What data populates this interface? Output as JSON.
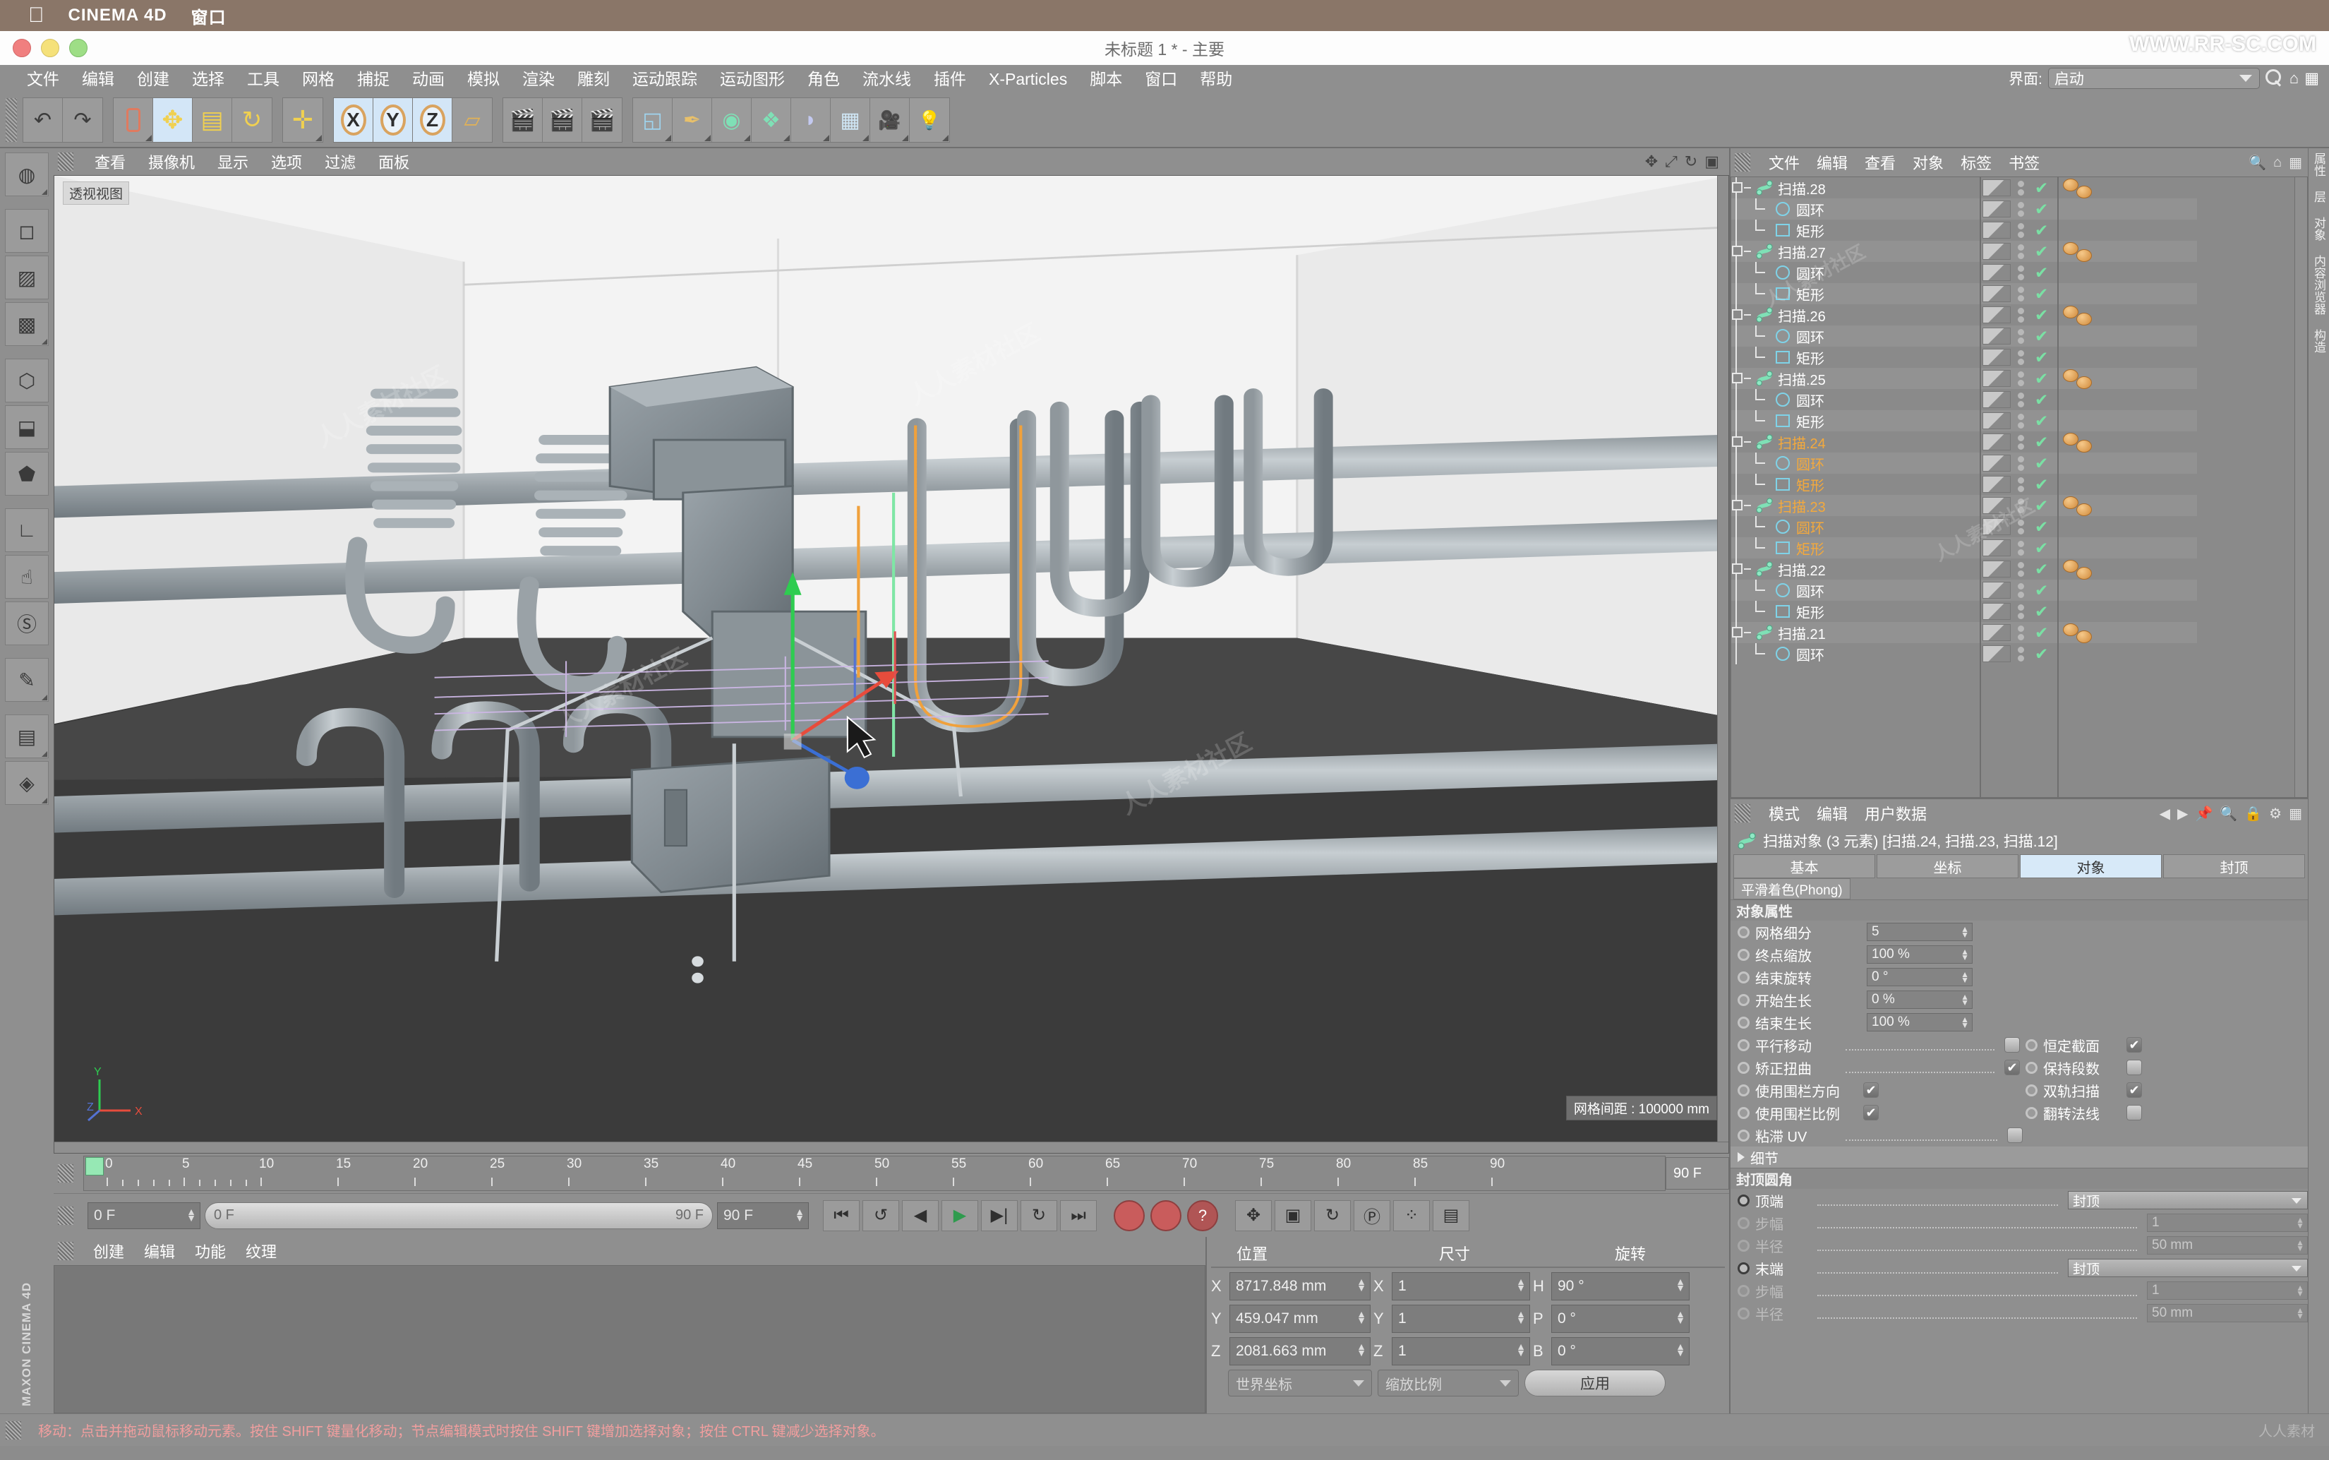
{
  "os": {
    "apple": "",
    "app_name": "CINEMA 4D",
    "window_menu": "窗口"
  },
  "window": {
    "title": "未标题 1 * - 主要",
    "watermark": "WWW.RR-SC.COM"
  },
  "menubar": {
    "items": [
      "文件",
      "编辑",
      "创建",
      "选择",
      "工具",
      "网格",
      "捕捉",
      "动画",
      "模拟",
      "渲染",
      "雕刻",
      "运动跟踪",
      "运动图形",
      "角色",
      "流水线",
      "插件",
      "X-Particles",
      "脚本",
      "窗口",
      "帮助"
    ],
    "interface_label": "界面:",
    "interface_value": "启动"
  },
  "toolbar": {
    "groups": [
      {
        "buttons": [
          {
            "name": "undo",
            "glyph": "↶"
          },
          {
            "name": "redo",
            "glyph": "↷"
          }
        ]
      },
      {
        "buttons": [
          {
            "name": "live-selection",
            "glyph": "▯"
          },
          {
            "name": "move",
            "glyph": "✥",
            "active": true
          },
          {
            "name": "scale",
            "glyph": "▤"
          },
          {
            "name": "rotate",
            "glyph": "↻"
          }
        ]
      },
      {
        "buttons": [
          {
            "name": "move-tool",
            "glyph": "✛"
          }
        ]
      },
      {
        "buttons": [
          {
            "name": "axis-x",
            "glyph": "X",
            "active": true
          },
          {
            "name": "axis-y",
            "glyph": "Y",
            "active": true
          },
          {
            "name": "axis-z",
            "glyph": "Z",
            "active": true
          },
          {
            "name": "world-coord",
            "glyph": "▱"
          }
        ]
      },
      {
        "buttons": [
          {
            "name": "render-view",
            "glyph": "▶"
          },
          {
            "name": "render-region",
            "glyph": "▶"
          },
          {
            "name": "render-settings",
            "glyph": "▶"
          }
        ]
      },
      {
        "buttons": [
          {
            "name": "cube-primitive",
            "glyph": "◱"
          },
          {
            "name": "spline-pen",
            "glyph": "✒"
          },
          {
            "name": "nurbs",
            "glyph": "◉"
          },
          {
            "name": "array",
            "glyph": "❖"
          },
          {
            "name": "bend-deformer",
            "glyph": "◗"
          },
          {
            "name": "environment",
            "glyph": "▦"
          },
          {
            "name": "camera",
            "glyph": "📷"
          },
          {
            "name": "light",
            "glyph": "💡"
          }
        ]
      }
    ]
  },
  "leftstrip": {
    "buttons": [
      {
        "name": "texture-axis",
        "glyph": "◍"
      },
      {
        "name": "model-mode",
        "glyph": "◻"
      },
      {
        "name": "object-mode",
        "glyph": "▨"
      },
      {
        "name": "texture-mode",
        "glyph": "▩"
      },
      {
        "name": "points-mode",
        "glyph": "⬡"
      },
      {
        "name": "edges-mode",
        "glyph": "⬓"
      },
      {
        "name": "polygons-mode",
        "glyph": "⬟"
      },
      {
        "name": "workplane",
        "glyph": "∟"
      },
      {
        "name": "animation-mode",
        "glyph": "☝"
      },
      {
        "name": "lock-axis",
        "glyph": "Ⓢ"
      },
      {
        "name": "enable-snap",
        "glyph": "✎"
      },
      {
        "name": "lock-workplane",
        "glyph": "▤"
      },
      {
        "name": "planar-workplane",
        "glyph": "◈"
      }
    ],
    "brand": "MAXON CINEMA 4D"
  },
  "viewport": {
    "menu": [
      "查看",
      "摄像机",
      "显示",
      "选项",
      "过滤",
      "面板"
    ],
    "label": "透视视图",
    "grid_info": "网格间距 : 100000 mm",
    "axis": {
      "x": "X",
      "y": "Y",
      "z": "Z"
    }
  },
  "timeline": {
    "ticks": [
      0,
      5,
      10,
      15,
      20,
      25,
      30,
      35,
      40,
      45,
      50,
      55,
      60,
      65,
      70,
      75,
      80,
      85,
      90
    ],
    "playhead_frame": "0",
    "current_frame": "0 F",
    "range_start": "0 F",
    "range_end": "90 F",
    "end_frame": "90 F",
    "preview_end": "90 F"
  },
  "transport": {
    "buttons": [
      {
        "name": "go-to-start",
        "glyph": "⏮"
      },
      {
        "name": "play-reverse-loop",
        "glyph": "↺"
      },
      {
        "name": "step-back",
        "glyph": "◀"
      },
      {
        "name": "play",
        "glyph": "▶"
      },
      {
        "name": "step-forward",
        "glyph": "▶|"
      },
      {
        "name": "loop",
        "glyph": "↻"
      },
      {
        "name": "go-to-end",
        "glyph": "⏭"
      },
      {
        "name": "record-active-objects",
        "glyph": "●"
      },
      {
        "name": "autokey",
        "glyph": "●"
      },
      {
        "name": "keyframe-selection",
        "glyph": "?"
      },
      {
        "name": "position-key",
        "glyph": "✥"
      },
      {
        "name": "scale-key",
        "glyph": "▣"
      },
      {
        "name": "rotation-key",
        "glyph": "↻"
      },
      {
        "name": "param-key",
        "glyph": "P"
      },
      {
        "name": "pla-key",
        "glyph": "⁘"
      },
      {
        "name": "layout-key",
        "glyph": "▤"
      }
    ]
  },
  "materials": {
    "menu": [
      "创建",
      "编辑",
      "功能",
      "纹理"
    ]
  },
  "coordinates": {
    "headers": {
      "position": "位置",
      "size": "尺寸",
      "rotation": "旋转"
    },
    "rows": [
      {
        "axis_p": "X",
        "pos": "8717.848 mm",
        "axis_s": "X",
        "size": "1",
        "axis_r": "H",
        "rot": "90 °"
      },
      {
        "axis_p": "Y",
        "pos": "459.047 mm",
        "axis_s": "Y",
        "size": "1",
        "axis_r": "P",
        "rot": "0 °"
      },
      {
        "axis_p": "Z",
        "pos": "2081.663 mm",
        "axis_s": "Z",
        "size": "1",
        "axis_r": "B",
        "rot": "0 °"
      }
    ],
    "coord_system": "世界坐标",
    "scale_mode": "缩放比例",
    "apply": "应用"
  },
  "object_manager": {
    "menu": [
      "文件",
      "编辑",
      "查看",
      "对象",
      "标签",
      "书签"
    ],
    "rows": [
      {
        "depth": 0,
        "label": "扫描.28",
        "icon": "sweep-icon",
        "selected": false,
        "expanded": true,
        "tags": 2
      },
      {
        "depth": 1,
        "label": "圆环",
        "icon": "circle-spline-icon",
        "selected": false
      },
      {
        "depth": 1,
        "label": "矩形",
        "icon": "rect-spline-icon",
        "selected": false
      },
      {
        "depth": 0,
        "label": "扫描.27",
        "icon": "sweep-icon",
        "selected": false,
        "expanded": true,
        "tags": 2
      },
      {
        "depth": 1,
        "label": "圆环",
        "icon": "circle-spline-icon",
        "selected": false
      },
      {
        "depth": 1,
        "label": "矩形",
        "icon": "rect-spline-icon",
        "selected": false
      },
      {
        "depth": 0,
        "label": "扫描.26",
        "icon": "sweep-icon",
        "selected": false,
        "expanded": true,
        "tags": 2
      },
      {
        "depth": 1,
        "label": "圆环",
        "icon": "circle-spline-icon",
        "selected": false
      },
      {
        "depth": 1,
        "label": "矩形",
        "icon": "rect-spline-icon",
        "selected": false
      },
      {
        "depth": 0,
        "label": "扫描.25",
        "icon": "sweep-icon",
        "selected": false,
        "expanded": true,
        "tags": 2
      },
      {
        "depth": 1,
        "label": "圆环",
        "icon": "circle-spline-icon",
        "selected": false
      },
      {
        "depth": 1,
        "label": "矩形",
        "icon": "rect-spline-icon",
        "selected": false
      },
      {
        "depth": 0,
        "label": "扫描.24",
        "icon": "sweep-icon",
        "selected": true,
        "expanded": true,
        "tags": 2
      },
      {
        "depth": 1,
        "label": "圆环",
        "icon": "circle-spline-icon",
        "selected": true
      },
      {
        "depth": 1,
        "label": "矩形",
        "icon": "rect-spline-icon",
        "selected": true
      },
      {
        "depth": 0,
        "label": "扫描.23",
        "icon": "sweep-icon",
        "selected": true,
        "expanded": true,
        "tags": 2
      },
      {
        "depth": 1,
        "label": "圆环",
        "icon": "circle-spline-icon",
        "selected": true
      },
      {
        "depth": 1,
        "label": "矩形",
        "icon": "rect-spline-icon",
        "selected": true
      },
      {
        "depth": 0,
        "label": "扫描.22",
        "icon": "sweep-icon",
        "selected": false,
        "expanded": true,
        "tags": 2
      },
      {
        "depth": 1,
        "label": "圆环",
        "icon": "circle-spline-icon",
        "selected": false
      },
      {
        "depth": 1,
        "label": "矩形",
        "icon": "rect-spline-icon",
        "selected": false
      },
      {
        "depth": 0,
        "label": "扫描.21",
        "icon": "sweep-icon",
        "selected": false,
        "expanded": true,
        "tags": 2
      },
      {
        "depth": 1,
        "label": "圆环",
        "icon": "circle-spline-icon",
        "selected": false
      }
    ]
  },
  "attributes": {
    "menu": [
      "模式",
      "编辑",
      "用户数据"
    ],
    "object_title": "扫描对象 (3 元素) [扫描.24, 扫描.23, 扫描.12]",
    "tabs": [
      {
        "label": "基本",
        "selected": false
      },
      {
        "label": "坐标",
        "selected": false
      },
      {
        "label": "对象",
        "selected": true
      },
      {
        "label": "封顶",
        "selected": false
      }
    ],
    "tab2": "平滑着色(Phong)",
    "section_object": "对象属性",
    "props": [
      {
        "label": "网格细分",
        "value": "5",
        "type": "number"
      },
      {
        "label": "终点缩放",
        "value": "100 %",
        "type": "number"
      },
      {
        "label": "结束旋转",
        "value": "0 °",
        "type": "number"
      },
      {
        "label": "开始生长",
        "value": "0 %",
        "type": "number"
      },
      {
        "label": "结束生长",
        "value": "100 %",
        "type": "number"
      }
    ],
    "checks": [
      {
        "left_label": "平行移动",
        "left_checked": false,
        "right_label": "恒定截面",
        "right_checked": true
      },
      {
        "left_label": "矫正扭曲",
        "left_checked": true,
        "right_label": "保持段数",
        "right_checked": false
      },
      {
        "left_label": "使用围栏方向",
        "left_checked": true,
        "right_label": "双轨扫描",
        "right_checked": true
      },
      {
        "left_label": "使用围栏比例",
        "left_checked": true,
        "right_label": "翻转法线",
        "right_checked": false
      },
      {
        "left_label": "粘滞 UV",
        "left_checked": false,
        "right_label": "",
        "right_checked": null
      }
    ],
    "detail_fold": "细节",
    "section_cap": "封顶圆角",
    "cap_props": [
      {
        "label": "顶端",
        "value": "封顶",
        "type": "dropdown",
        "dim": false
      },
      {
        "label": "步幅",
        "value": "1",
        "type": "number",
        "dim": true
      },
      {
        "label": "半径",
        "value": "50 mm",
        "type": "number",
        "dim": true
      },
      {
        "label": "末端",
        "value": "封顶",
        "type": "dropdown",
        "dim": false
      },
      {
        "label": "步幅",
        "value": "1",
        "type": "number",
        "dim": true
      },
      {
        "label": "半径",
        "value": "50 mm",
        "type": "number",
        "dim": true
      }
    ],
    "vtabs": [
      "属性",
      "层",
      "对象",
      "内容浏览器",
      "构造"
    ]
  },
  "statusbar": {
    "text": "移动：点击并拖动鼠标移动元素。按住 SHIFT 键量化移动；节点编辑模式时按住 SHIFT 键增加选择对象；按住 CTRL 键减少选择对象。"
  },
  "colors": {
    "panel_bg": "#8f8f8f",
    "accent_selected": "#f4a93c",
    "accent_tab": "#d7e9f8",
    "check_green": "#7ae0a4",
    "playhead_green": "#96e8b4",
    "status_text": "#f19e9e"
  }
}
